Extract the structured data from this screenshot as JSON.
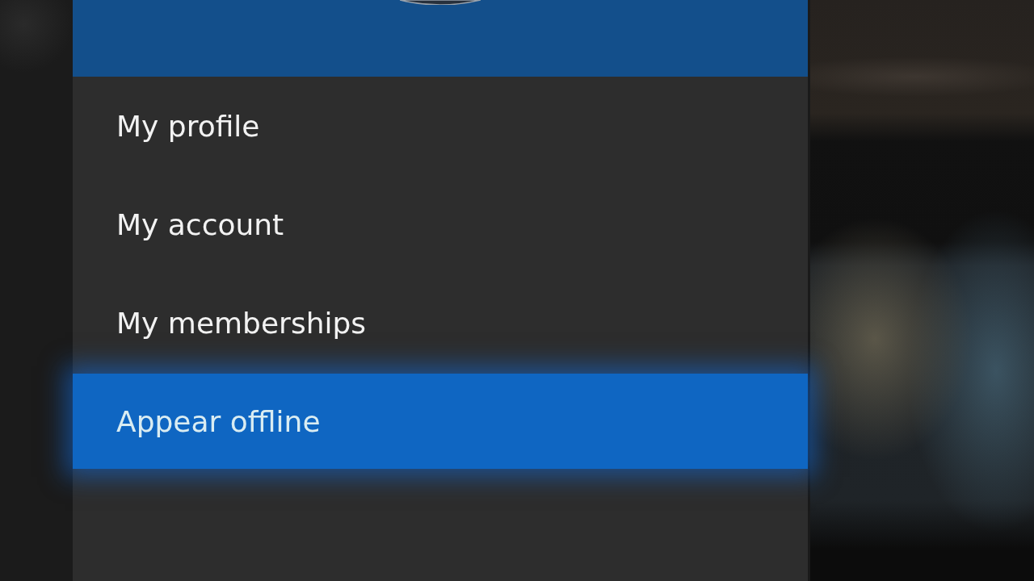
{
  "menu": {
    "items": [
      {
        "label": "My profile",
        "selected": false
      },
      {
        "label": "My account",
        "selected": false
      },
      {
        "label": "My memberships",
        "selected": false
      },
      {
        "label": "Appear offline",
        "selected": true
      }
    ]
  }
}
